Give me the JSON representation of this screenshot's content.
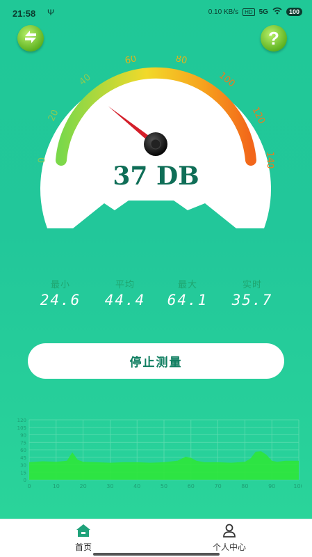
{
  "status_bar": {
    "time": "21:58",
    "usb_glyph": "Ψ",
    "net_speed": "0.10 KB/s",
    "hd": "HD",
    "signal": "5G",
    "battery": "100"
  },
  "header": {
    "refresh_icon": "refresh-arrows-icon",
    "help_label": "?"
  },
  "gauge": {
    "ticks": [
      "0",
      "20",
      "40",
      "60",
      "80",
      "100",
      "120",
      "140"
    ],
    "min": 0,
    "max": 140,
    "needle_value": 37,
    "readout": "37 DB"
  },
  "stats": {
    "items": [
      {
        "label": "最小",
        "value": "24.6"
      },
      {
        "label": "平均",
        "value": "44.4"
      },
      {
        "label": "最大",
        "value": "64.1"
      },
      {
        "label": "实时",
        "value": "35.7"
      }
    ]
  },
  "controls": {
    "stop_label": "停止测量"
  },
  "chart_data": {
    "type": "area",
    "color": "#2ee63a",
    "ylim": [
      0,
      120
    ],
    "x_ticks": [
      "0",
      "10",
      "20",
      "30",
      "40",
      "50",
      "60",
      "70",
      "80",
      "90",
      "100"
    ],
    "y_ticks": [
      "120",
      "105",
      "90",
      "75",
      "60",
      "45",
      "30",
      "15",
      "0"
    ],
    "x": [
      0,
      5,
      10,
      14,
      16,
      18,
      20,
      25,
      30,
      35,
      40,
      45,
      50,
      55,
      58,
      60,
      62,
      65,
      70,
      75,
      80,
      82,
      84,
      86,
      88,
      90,
      92,
      95,
      100
    ],
    "values": [
      35,
      37,
      36,
      38,
      55,
      40,
      36,
      35,
      34,
      35,
      35,
      34,
      35,
      38,
      46,
      44,
      38,
      35,
      35,
      34,
      36,
      42,
      56,
      57,
      50,
      38,
      36,
      38,
      38
    ]
  },
  "tabs": [
    {
      "label": "首页",
      "icon": "home-icon",
      "active": true
    },
    {
      "label": "个人中心",
      "icon": "user-icon",
      "active": false
    }
  ],
  "colors": {
    "background": "#22c79a",
    "accent": "#0f6e57",
    "needle": "#d41f2a"
  }
}
